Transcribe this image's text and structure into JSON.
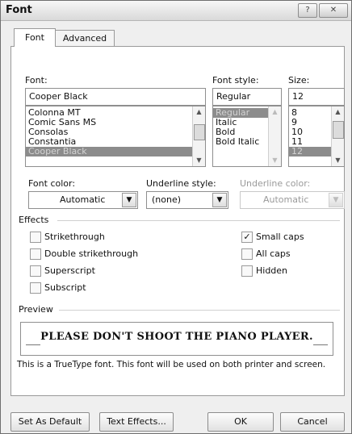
{
  "window": {
    "title": "Font",
    "help_label": "?",
    "close_label": "✕"
  },
  "tabs": [
    {
      "label": "Font"
    },
    {
      "label": "Advanced"
    }
  ],
  "font": {
    "label": "Font:",
    "value": "Cooper Black",
    "list": [
      "Colonna MT",
      "Comic Sans MS",
      "Consolas",
      "Constantia",
      "Cooper Black"
    ],
    "selected_index": 4
  },
  "style": {
    "label": "Font style:",
    "value": "Regular",
    "list": [
      "Regular",
      "Italic",
      "Bold",
      "Bold Italic"
    ],
    "selected_index": 0
  },
  "size": {
    "label": "Size:",
    "value": "12",
    "list": [
      "8",
      "9",
      "10",
      "11",
      "12"
    ],
    "selected_index": 4
  },
  "font_color": {
    "label": "Font color:",
    "value": "Automatic"
  },
  "underline_style": {
    "label": "Underline style:",
    "value": "(none)"
  },
  "underline_color": {
    "label": "Underline color:",
    "value": "Automatic"
  },
  "effects": {
    "label": "Effects",
    "items": [
      {
        "label": "Strikethrough",
        "checked": false
      },
      {
        "label": "Double strikethrough",
        "checked": false
      },
      {
        "label": "Superscript",
        "checked": false
      },
      {
        "label": "Subscript",
        "checked": false
      },
      {
        "label": "Small caps",
        "checked": true
      },
      {
        "label": "All caps",
        "checked": false
      },
      {
        "label": "Hidden",
        "checked": false
      }
    ],
    "check_glyph": "✓"
  },
  "preview": {
    "label": "Preview",
    "text": "PLEASE DON'T SHOOT THE PIANO PLAYER.",
    "note": "This is a TrueType font. This font will be used on both printer and screen."
  },
  "buttons": {
    "set_default": "Set As Default",
    "text_effects": "Text Effects...",
    "ok": "OK",
    "cancel": "Cancel"
  },
  "icons": {
    "scroll_up": "▲",
    "scroll_down": "▼",
    "dropdown": "▼"
  }
}
